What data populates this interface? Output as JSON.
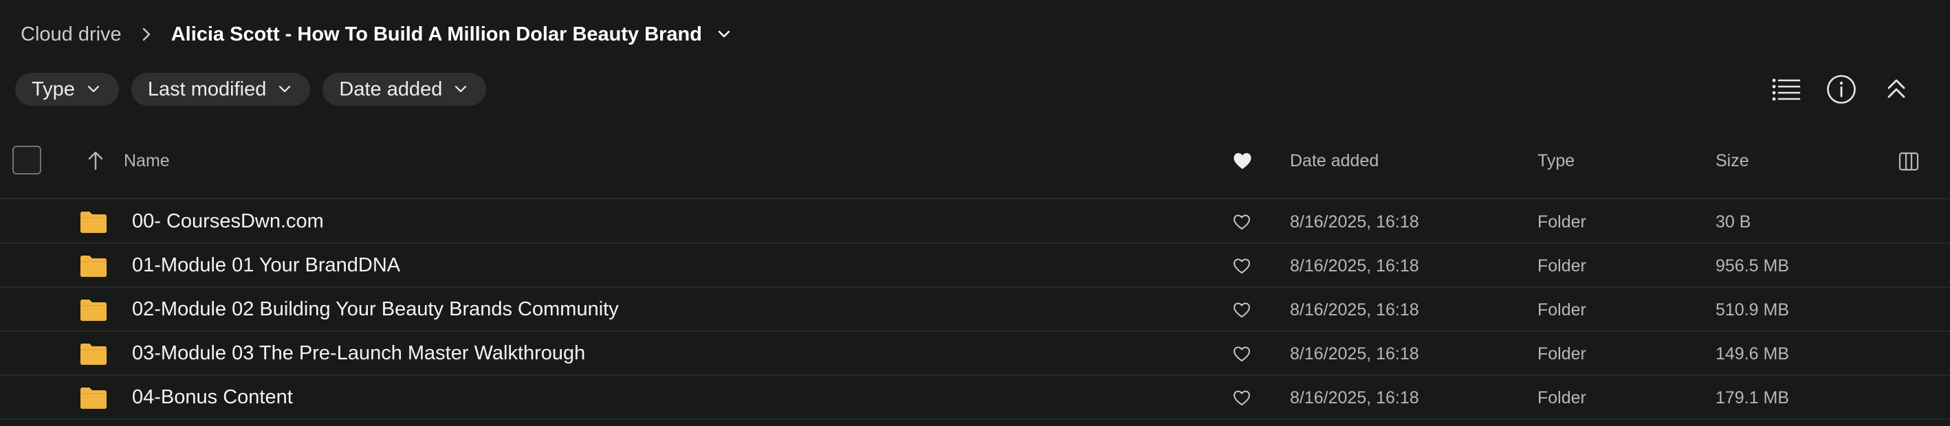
{
  "breadcrumb": {
    "root": "Cloud drive",
    "current": "Alicia Scott - How To Build A Million Dolar Beauty Brand"
  },
  "filters": [
    {
      "label": "Type"
    },
    {
      "label": "Last modified"
    },
    {
      "label": "Date added"
    }
  ],
  "toolbar": {
    "list_view_icon": "list-icon",
    "info_icon": "info-icon",
    "collapse_icon": "double-chevron-up-icon"
  },
  "table": {
    "columns": {
      "name": "Name",
      "favorite_icon": "heart-icon",
      "date_added": "Date added",
      "type": "Type",
      "size": "Size",
      "columns_icon": "columns-icon"
    },
    "rows": [
      {
        "name": "00- CoursesDwn.com",
        "date_added": "8/16/2025, 16:18",
        "type": "Folder",
        "size": "30 B"
      },
      {
        "name": "01-Module 01 Your BrandDNA",
        "date_added": "8/16/2025, 16:18",
        "type": "Folder",
        "size": "956.5 MB"
      },
      {
        "name": "02-Module 02 Building Your Beauty Brands Community",
        "date_added": "8/16/2025, 16:18",
        "type": "Folder",
        "size": "510.9 MB"
      },
      {
        "name": "03-Module 03 The Pre-Launch Master Walkthrough",
        "date_added": "8/16/2025, 16:18",
        "type": "Folder",
        "size": "149.6 MB"
      },
      {
        "name": "04-Bonus Content",
        "date_added": "8/16/2025, 16:18",
        "type": "Folder",
        "size": "179.1 MB"
      }
    ]
  },
  "colors": {
    "background": "#181a19",
    "chip_background": "#2d302f",
    "folder": "#f2b63f",
    "divider": "#262928"
  }
}
